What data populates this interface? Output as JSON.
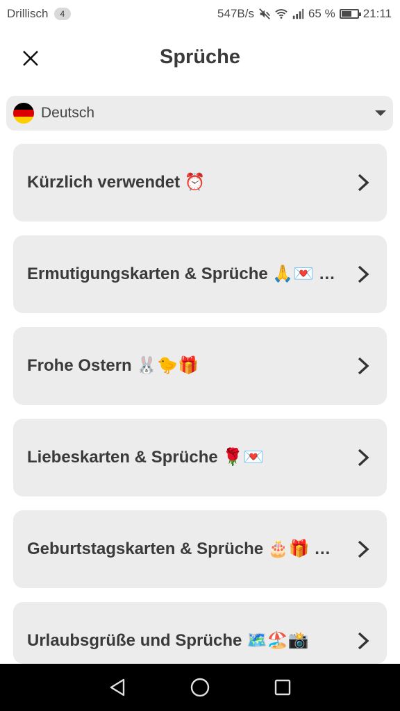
{
  "status_bar": {
    "carrier": "Drillisch",
    "notification_count": "4",
    "net_speed": "547B/s",
    "battery_percent": "65 %",
    "battery_level": 0.65,
    "time": "21:11",
    "icons": [
      "mute-icon",
      "wifi-icon",
      "signal-icon",
      "battery-icon"
    ]
  },
  "header": {
    "title": "Sprüche",
    "close_icon": "close-icon"
  },
  "language": {
    "selected": "Deutsch",
    "flag_colors": [
      "#000000",
      "#dd0000",
      "#ffce00"
    ]
  },
  "categories": [
    {
      "label": "Kürzlich verwendet ⏰"
    },
    {
      "label": "Ermutigungskarten & Sprüche 🙏💌 …"
    },
    {
      "label": "Frohe Ostern 🐰🐤🎁"
    },
    {
      "label": "Liebeskarten & Sprüche 🌹💌"
    },
    {
      "label": "Geburtstagskarten & Sprüche 🎂🎁 …"
    },
    {
      "label": "Urlaubsgrüße und Sprüche 🗺️🏖️📸"
    }
  ],
  "colors": {
    "card_bg": "#ececec",
    "text": "#3a3a3a",
    "nav_bg": "#000000"
  }
}
